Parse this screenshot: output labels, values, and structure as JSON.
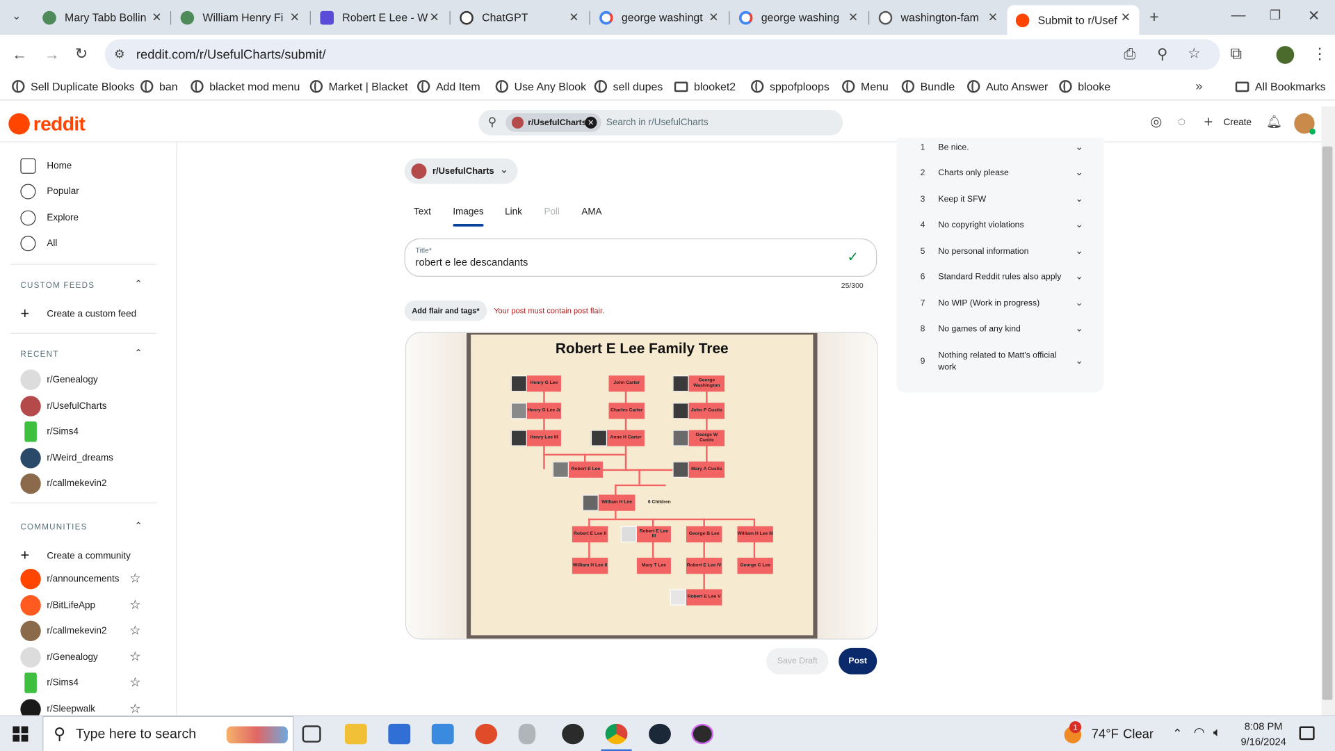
{
  "browser": {
    "tabs": [
      {
        "title": "Mary Tabb Bollin",
        "icon": "leaf-icon",
        "color": "#4f8a5b"
      },
      {
        "title": "William Henry Fi",
        "icon": "leaf-icon",
        "color": "#4f8a5b"
      },
      {
        "title": "Robert E Lee - W",
        "icon": "wikiwand-icon",
        "color": "#5b4bd8"
      },
      {
        "title": "ChatGPT",
        "icon": "openai-icon",
        "color": "#333333"
      },
      {
        "title": "george washingt",
        "icon": "google-icon",
        "color": "#4285f4"
      },
      {
        "title": "george washing",
        "icon": "google-icon",
        "color": "#4285f4"
      },
      {
        "title": "washington-fam",
        "icon": "globe-icon",
        "color": "#555555"
      },
      {
        "title": "Submit to r/Usef",
        "icon": "reddit-icon",
        "color": "#ff4500"
      }
    ],
    "url": "reddit.com/r/UsefulCharts/submit/",
    "bookmarks": [
      "Sell Duplicate Blooks",
      "ban",
      "blacket mod menu",
      "Market | Blacket",
      "Add Item",
      "Use Any Blook",
      "sell dupes",
      "blooket2",
      "sppofploops",
      "Menu",
      "Bundle",
      "Auto Answer",
      "blooke"
    ],
    "all_bookmarks": "All Bookmarks"
  },
  "reddit": {
    "logo": "reddit",
    "search_chip": "r/UsefulCharts",
    "search_placeholder": "Search in r/UsefulCharts",
    "create_label": "Create"
  },
  "sidebar": {
    "nav": [
      "Home",
      "Popular",
      "Explore",
      "All"
    ],
    "custom_feeds_header": "CUSTOM FEEDS",
    "create_feed": "Create a custom feed",
    "recent_header": "RECENT",
    "recent": [
      "r/Genealogy",
      "r/UsefulCharts",
      "r/Sims4",
      "r/Weird_dreams",
      "r/callmekevin2"
    ],
    "communities_header": "COMMUNITIES",
    "create_community": "Create a community",
    "communities": [
      "r/announcements",
      "r/BitLifeApp",
      "r/callmekevin2",
      "r/Genealogy",
      "r/Sims4",
      "r/Sleepwalk"
    ]
  },
  "post": {
    "community": "r/UsefulCharts",
    "tabs": [
      "Text",
      "Images",
      "Link",
      "Poll",
      "AMA"
    ],
    "title_label": "Title*",
    "title_value": "robert e lee descandants",
    "char_count": "25/300",
    "flair_button": "Add flair and tags*",
    "flair_error": "Your post must contain post flair.",
    "save_draft": "Save Draft",
    "post": "Post"
  },
  "chart": {
    "title": "Robert E Lee Family Tree",
    "people": {
      "henry_g_lee": "Henry G Lee",
      "henry_g_lee_jr": "Henry G Lee Jr",
      "henry_lee_iii": "Henry Lee III",
      "john_carter": "John Carter",
      "charles_carter": "Charles Carter",
      "anne_h_carter": "Anne H Carter",
      "george_washington": "George Washington",
      "john_p_custis": "John P Custis",
      "george_w_custis": "George W Custis",
      "robert_e_lee": "Robert E Lee",
      "mary_a_custis": "Mary A Custis",
      "william_h_lee": "William H Lee",
      "six_children": "6 Children",
      "robert_e_lee_ii": "Robert E Lee II",
      "robert_e_lee_iii": "Robert E Lee III",
      "george_b_lee": "George B Lee",
      "william_h_lee_iii": "William H Lee III",
      "william_h_lee_ii": "William H Lee II",
      "mary_t_lee": "Mary T Lee",
      "robert_e_lee_iv": "Robert E Lee IV",
      "george_c_lee": "George C Lee",
      "robert_e_lee_v": "Robert E Lee V"
    }
  },
  "rules": [
    {
      "n": "1",
      "text": "Be nice."
    },
    {
      "n": "2",
      "text": "Charts only please"
    },
    {
      "n": "3",
      "text": "Keep it SFW"
    },
    {
      "n": "4",
      "text": "No copyright violations"
    },
    {
      "n": "5",
      "text": "No personal information"
    },
    {
      "n": "6",
      "text": "Standard Reddit rules also apply"
    },
    {
      "n": "7",
      "text": "No WIP (Work in progress)"
    },
    {
      "n": "8",
      "text": "No games of any kind"
    },
    {
      "n": "9",
      "text": "Nothing related to Matt's official work"
    }
  ],
  "taskbar": {
    "search_placeholder": "Type here to search",
    "weather_temp": "74°F",
    "weather_cond": "Clear",
    "weather_badge": "1",
    "time": "8:08 PM",
    "date": "9/16/2024"
  },
  "colors": {
    "reddit_orange": "#ff4500",
    "post_button": "#0a2a6c",
    "tree_box": "#f26464",
    "tree_bg": "#f6ead0",
    "error": "#b32020"
  }
}
